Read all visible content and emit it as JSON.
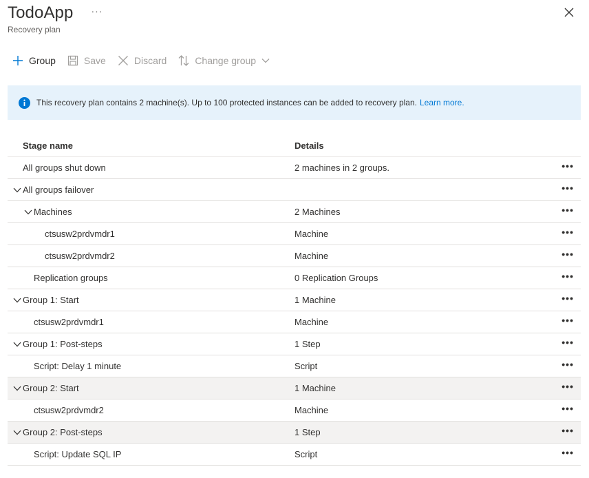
{
  "header": {
    "title": "TodoApp",
    "subtitle": "Recovery plan",
    "more_label": "···"
  },
  "toolbar": {
    "group_label": "Group",
    "save_label": "Save",
    "discard_label": "Discard",
    "change_group_label": "Change group"
  },
  "info": {
    "message": "This recovery plan contains 2 machine(s). Up to 100 protected instances can be added to recovery plan.",
    "link": "Learn more."
  },
  "grid": {
    "col_stage": "Stage name",
    "col_details": "Details",
    "row_more": "•••",
    "rows": [
      {
        "name": "All groups shut down",
        "details": "2 machines in 2 groups.",
        "level": 0,
        "expandable": false,
        "highlight": false
      },
      {
        "name": "All groups failover",
        "details": "",
        "level": 0,
        "expandable": true,
        "highlight": false
      },
      {
        "name": "Machines",
        "details": "2 Machines",
        "level": 1,
        "expandable": true,
        "highlight": false
      },
      {
        "name": "ctsusw2prdvmdr1",
        "details": "Machine",
        "level": 2,
        "expandable": false,
        "highlight": false
      },
      {
        "name": "ctsusw2prdvmdr2",
        "details": "Machine",
        "level": 2,
        "expandable": false,
        "highlight": false
      },
      {
        "name": "Replication groups",
        "details": "0 Replication Groups",
        "level": 1,
        "expandable": false,
        "highlight": false
      },
      {
        "name": "Group 1: Start",
        "details": "1 Machine",
        "level": 0,
        "expandable": true,
        "highlight": false
      },
      {
        "name": "ctsusw2prdvmdr1",
        "details": "Machine",
        "level": 1,
        "expandable": false,
        "highlight": false
      },
      {
        "name": "Group 1: Post-steps",
        "details": "1 Step",
        "level": 0,
        "expandable": true,
        "highlight": false
      },
      {
        "name": "Script: Delay 1 minute",
        "details": "Script",
        "level": 1,
        "expandable": false,
        "highlight": false
      },
      {
        "name": "Group 2: Start",
        "details": "1 Machine",
        "level": 0,
        "expandable": true,
        "highlight": true
      },
      {
        "name": "ctsusw2prdvmdr2",
        "details": "Machine",
        "level": 1,
        "expandable": false,
        "highlight": false
      },
      {
        "name": "Group 2: Post-steps",
        "details": "1 Step",
        "level": 0,
        "expandable": true,
        "highlight": true
      },
      {
        "name": "Script: Update SQL IP",
        "details": "Script",
        "level": 1,
        "expandable": false,
        "highlight": false
      }
    ]
  },
  "colors": {
    "accent": "#0078d4",
    "info_bg": "#e6f2fb",
    "highlight_row": "#f3f2f1"
  }
}
